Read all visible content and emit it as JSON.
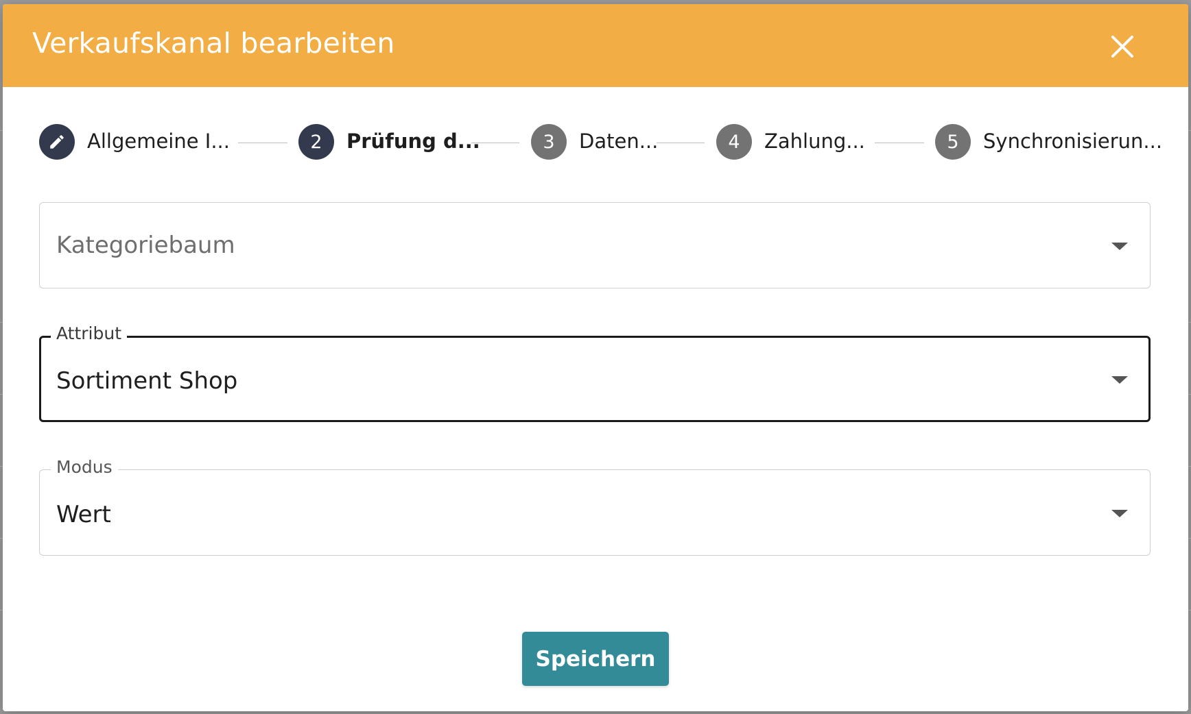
{
  "dialog": {
    "title": "Verkaufskanal bearbeiten",
    "close_icon": "close-icon"
  },
  "stepper": {
    "steps": [
      {
        "number": "",
        "icon": "pencil-icon",
        "label": "Allgemeine I...",
        "state": "completed"
      },
      {
        "number": "2",
        "label": "Prüfung d...",
        "state": "active"
      },
      {
        "number": "3",
        "label": "Daten...",
        "state": "inactive"
      },
      {
        "number": "4",
        "label": "Zahlung...",
        "state": "inactive"
      },
      {
        "number": "5",
        "label": "Synchronisierun...",
        "state": "inactive"
      }
    ]
  },
  "form": {
    "kategoriebaum": {
      "placeholder": "Kategoriebaum",
      "value": ""
    },
    "attribut": {
      "label": "Attribut",
      "value": "Sortiment Shop"
    },
    "modus": {
      "label": "Modus",
      "value": "Wert"
    }
  },
  "actions": {
    "save_label": "Speichern"
  },
  "colors": {
    "header": "#f2ad44",
    "step_active": "#333a4d",
    "step_inactive": "#737373",
    "save_button": "#348b98"
  }
}
